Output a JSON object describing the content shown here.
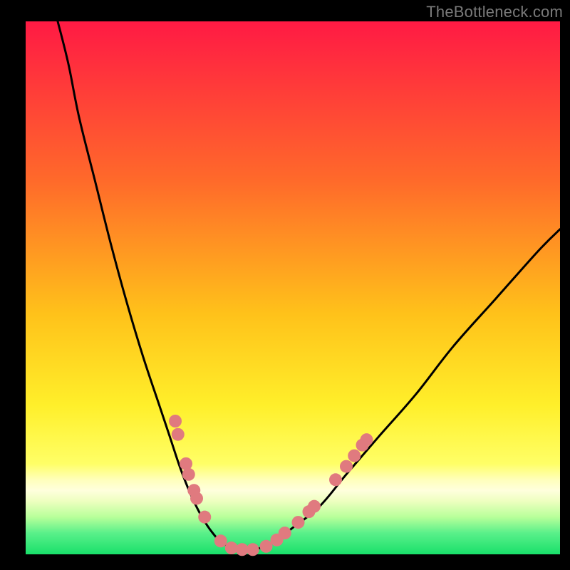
{
  "watermark": "TheBottleneck.com",
  "colors": {
    "frame_bg": "#000000",
    "grad_top": "#ff1a44",
    "grad_mid1": "#ff6a2a",
    "grad_mid2": "#ffd21a",
    "grad_mid3": "#ffff55",
    "grad_band_pale": "#ffffbb",
    "grad_bottom": "#19e06a",
    "curve": "#000000",
    "dot_fill": "#e07a7f",
    "dot_stroke": "#c95a60"
  },
  "chart_data": {
    "type": "line",
    "title": "",
    "xlabel": "",
    "ylabel": "",
    "xlim": [
      0,
      100
    ],
    "ylim": [
      0,
      100
    ],
    "grid": false,
    "legend": false,
    "series": [
      {
        "name": "bottleneck-curve",
        "x": [
          6,
          8,
          10,
          13,
          16,
          19,
          22,
          25,
          27,
          29,
          31,
          33,
          35,
          37,
          40,
          43,
          46,
          50,
          55,
          60,
          66,
          73,
          80,
          88,
          96,
          100
        ],
        "y": [
          100,
          92,
          82,
          70,
          58,
          47,
          37,
          28,
          22,
          16,
          11,
          7,
          4,
          2,
          1,
          1,
          2,
          5,
          9,
          15,
          22,
          30,
          39,
          48,
          57,
          61
        ]
      }
    ],
    "scatter": [
      {
        "name": "highlight-dots",
        "points": [
          {
            "x": 28.0,
            "y": 25.0
          },
          {
            "x": 28.5,
            "y": 22.5
          },
          {
            "x": 30.0,
            "y": 17.0
          },
          {
            "x": 30.5,
            "y": 15.0
          },
          {
            "x": 31.5,
            "y": 12.0
          },
          {
            "x": 32.0,
            "y": 10.5
          },
          {
            "x": 33.5,
            "y": 7.0
          },
          {
            "x": 36.5,
            "y": 2.5
          },
          {
            "x": 38.5,
            "y": 1.2
          },
          {
            "x": 40.5,
            "y": 0.9
          },
          {
            "x": 42.5,
            "y": 0.9
          },
          {
            "x": 45.0,
            "y": 1.5
          },
          {
            "x": 47.0,
            "y": 2.7
          },
          {
            "x": 48.5,
            "y": 4.0
          },
          {
            "x": 51.0,
            "y": 6.0
          },
          {
            "x": 53.0,
            "y": 8.0
          },
          {
            "x": 54.0,
            "y": 9.0
          },
          {
            "x": 58.0,
            "y": 14.0
          },
          {
            "x": 60.0,
            "y": 16.5
          },
          {
            "x": 61.5,
            "y": 18.5
          },
          {
            "x": 63.0,
            "y": 20.5
          },
          {
            "x": 63.8,
            "y": 21.5
          }
        ]
      }
    ]
  }
}
